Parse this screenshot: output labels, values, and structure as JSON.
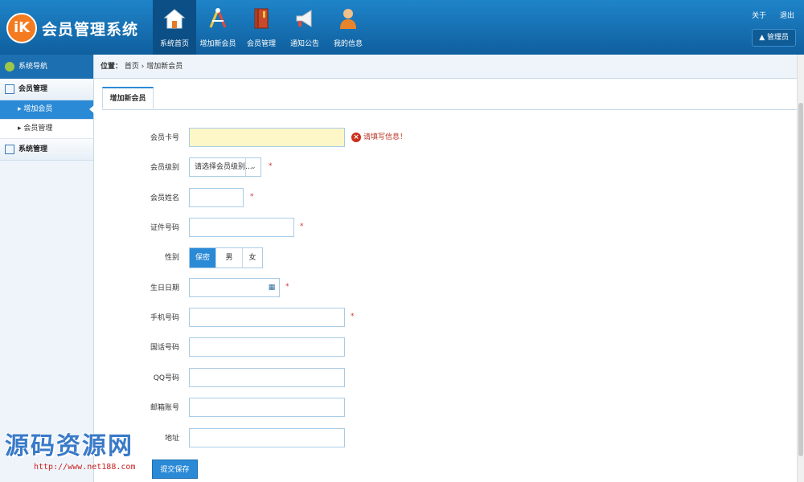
{
  "header": {
    "logo_mark": "iK",
    "app_title": "会员管理系统",
    "nav": [
      {
        "label": "系统首页",
        "icon": "home-icon",
        "active": true
      },
      {
        "label": "增加新会员",
        "icon": "tools-icon",
        "active": false
      },
      {
        "label": "会员管理",
        "icon": "book-icon",
        "active": false
      },
      {
        "label": "通知公告",
        "icon": "megaphone-icon",
        "active": false
      },
      {
        "label": "我的信息",
        "icon": "user-icon",
        "active": false
      }
    ],
    "about_label": "关于",
    "logout_label": "退出",
    "admin_label": "管理员"
  },
  "sidebar": {
    "header": "系统导航",
    "groups": [
      {
        "label": "会员管理",
        "items": [
          {
            "label": "增加会员",
            "active": true
          },
          {
            "label": "会员管理",
            "active": false
          }
        ]
      },
      {
        "label": "系统管理",
        "items": []
      }
    ]
  },
  "breadcrumb": {
    "prefix": "位置：",
    "home": "首页",
    "sep": "›",
    "current": "增加新会员"
  },
  "tab": {
    "label": "增加新会员"
  },
  "form": {
    "card_no_label": "会员卡号",
    "card_no_error": "请填写信息！",
    "level_label": "会员级别",
    "level_value": "请选择会员级别...",
    "name_label": "会员姓名",
    "id_label": "证件号码",
    "gender_label": "性别",
    "gender_options": [
      "保密",
      "男",
      "女"
    ],
    "gender_selected": "保密",
    "birthday_label": "生日日期",
    "mobile_label": "手机号码",
    "phone_label": "国话号码",
    "qq_label": "QQ号码",
    "email_label": "邮箱账号",
    "address_label": "地址",
    "required_mark": "*",
    "submit_label": "提交保存"
  },
  "watermark": {
    "title": "源码资源网",
    "url": "http://www.net188.com"
  },
  "colors": {
    "header": "#1f84c9",
    "accent": "#2b8ad6",
    "error": "#cc2e1c",
    "highlight_input": "#fdf7c8"
  }
}
